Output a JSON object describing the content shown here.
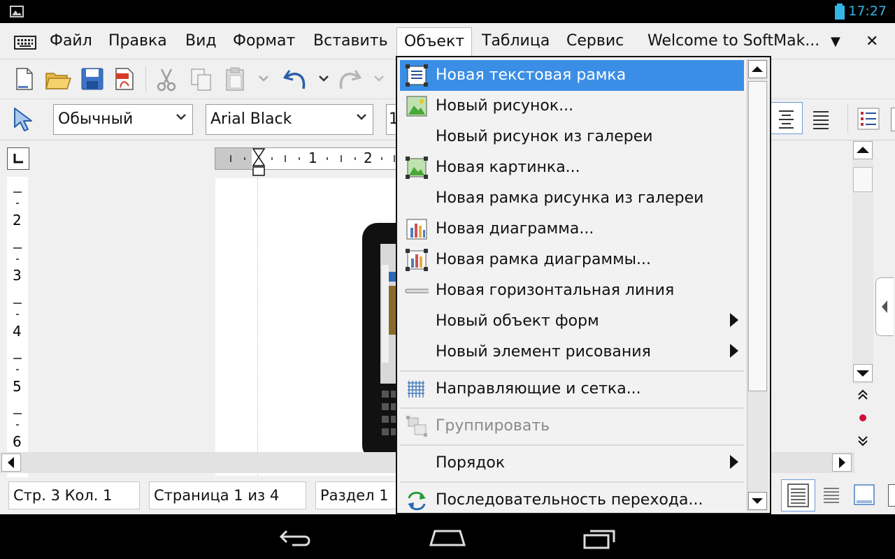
{
  "status": {
    "time": "17:27"
  },
  "menubar": {
    "items": [
      "Файл",
      "Правка",
      "Вид",
      "Формат",
      "Вставить",
      "Объект",
      "Таблица",
      "Сервис"
    ],
    "tab_title": "Welcome to SoftMak...",
    "tab_arrow": "▼",
    "close": "✕"
  },
  "toolbar2": {
    "style_value": "Обычный",
    "font_value": "Arial Black",
    "size_partial": "1"
  },
  "ruler": {
    "h_labels": [
      "1",
      "2"
    ],
    "v_labels": [
      "2",
      "3",
      "4",
      "5",
      "6"
    ]
  },
  "statusbar": {
    "pos": "Стр. 3 Кол. 1",
    "page": "Страница 1 из 4",
    "section": "Раздел 1"
  },
  "dropdown": {
    "items": [
      {
        "label": "Новая текстовая рамка",
        "icon": "text-frame-icon",
        "selected": true
      },
      {
        "label": "Новый рисунок...",
        "icon": "picture-icon"
      },
      {
        "label": "Новый рисунок из галереи",
        "icon": ""
      },
      {
        "label": "Новая картинка...",
        "icon": "picture-frame-icon"
      },
      {
        "label": "Новая рамка рисунка из галереи",
        "icon": ""
      },
      {
        "label": "Новая диаграмма...",
        "icon": "chart-icon"
      },
      {
        "label": "Новая рамка диаграммы...",
        "icon": "chart-frame-icon"
      },
      {
        "label": "Новая горизонтальная линия",
        "icon": "horizontal-line-icon"
      },
      {
        "label": "Новый объект форм",
        "icon": "",
        "submenu": true
      },
      {
        "label": "Новый элемент рисования",
        "icon": "",
        "submenu": true
      },
      {
        "label": "Направляющие и сетка...",
        "icon": "grid-icon"
      },
      {
        "label": "Группировать",
        "icon": "group-icon",
        "disabled": true
      },
      {
        "label": "Порядок",
        "icon": "",
        "submenu": true
      },
      {
        "label": "Последовательность перехода...",
        "icon": "tab-order-icon"
      }
    ]
  }
}
